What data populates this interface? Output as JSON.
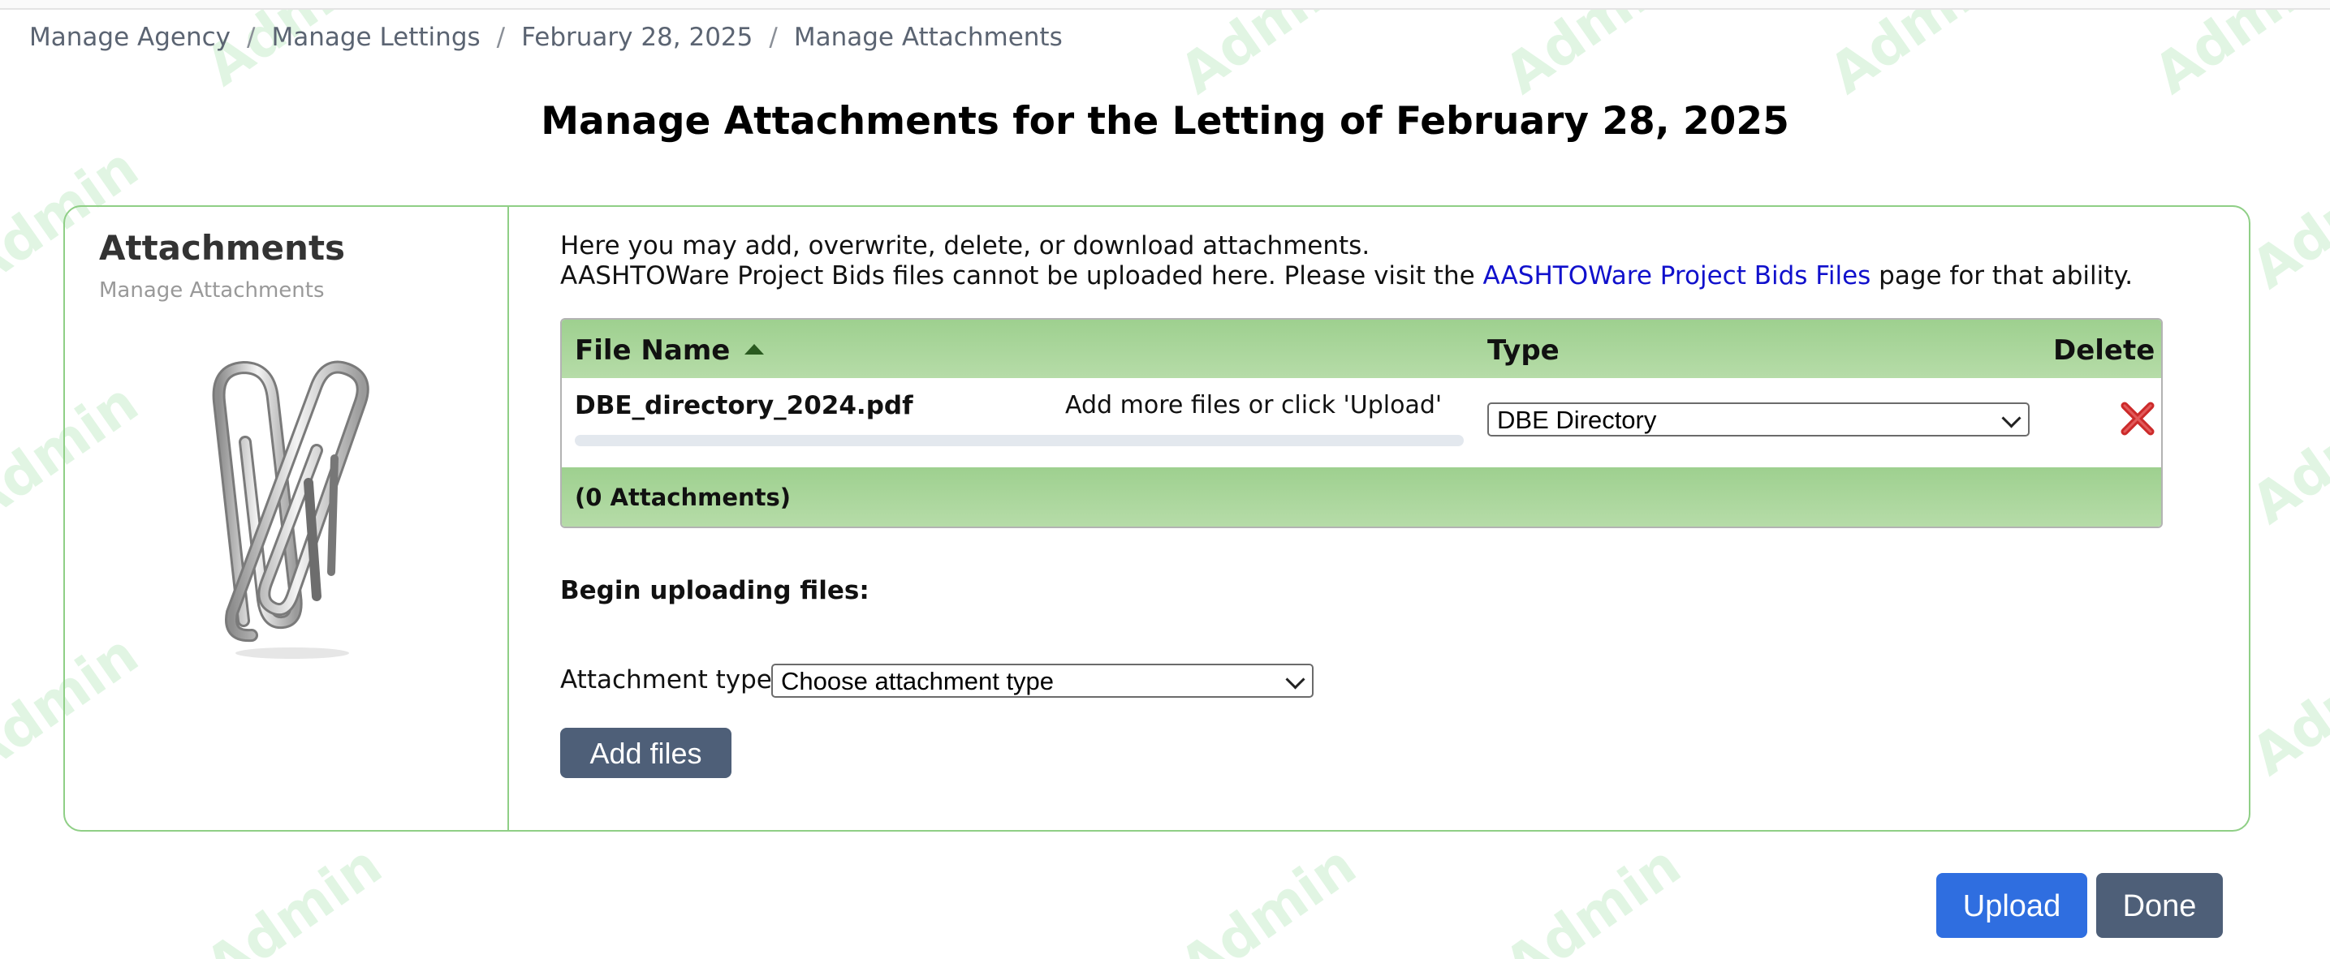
{
  "breadcrumb": {
    "items": [
      "Manage Agency",
      "Manage Lettings",
      "February 28, 2025",
      "Manage Attachments"
    ],
    "separator": "/"
  },
  "page_title": "Manage Attachments for the Letting of February 28, 2025",
  "watermark_text": "Admin",
  "sidebar": {
    "title": "Attachments",
    "subtitle": "Manage Attachments",
    "icon": "paperclip-icon"
  },
  "intro": {
    "line1": "Here you may add, overwrite, delete, or download attachments.",
    "line2_prefix": "AASHTOWare Project Bids files cannot be uploaded here. Please visit the ",
    "line2_link": "AASHTOWare Project Bids Files",
    "line2_suffix": " page for that ability."
  },
  "grid": {
    "headers": {
      "file_name": "File Name",
      "type": "Type",
      "delete": "Delete"
    },
    "sort_icon": "sort-ascending-icon",
    "rows": [
      {
        "file_name": "DBE_directory_2024.pdf",
        "hint": "Add more files or click 'Upload'",
        "type": "DBE Directory",
        "delete_icon": "delete-x-icon"
      }
    ],
    "footer": "(0 Attachments)"
  },
  "upload": {
    "heading": "Begin uploading files:",
    "attachment_type_label": "Attachment type",
    "attachment_type_value": "Choose attachment type",
    "add_files_label": "Add files"
  },
  "actions": {
    "upload_label": "Upload",
    "done_label": "Done"
  },
  "colors": {
    "accent_green": "#8fcf86",
    "upload_button": "#2f6ee0",
    "neutral_button": "#4e5f78",
    "link": "#1010cc",
    "delete_red": "#cc2a2a"
  }
}
